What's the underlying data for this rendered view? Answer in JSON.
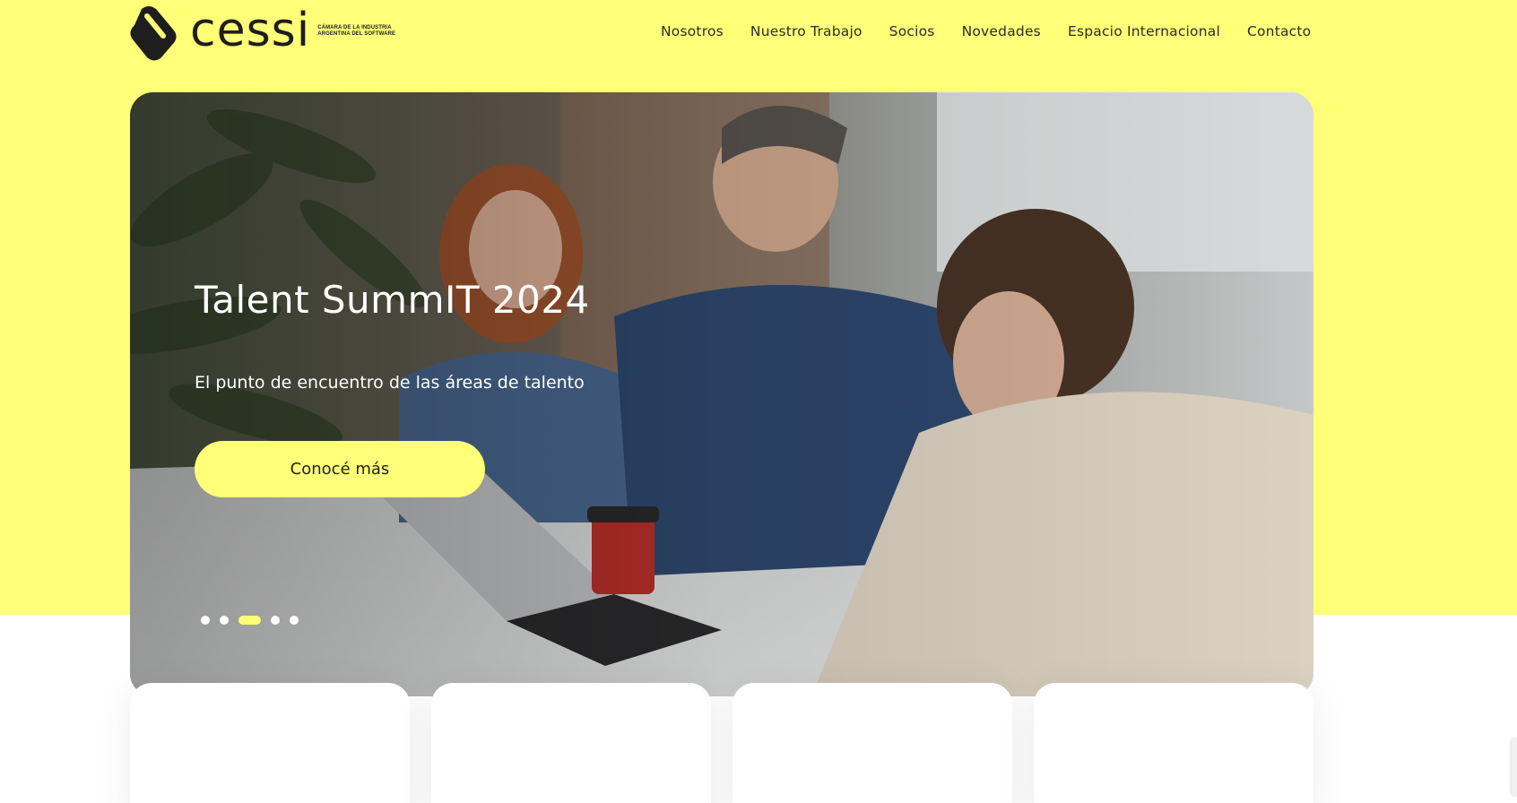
{
  "brand": {
    "name": "cessi",
    "subtitle_line1": "CÁMARA DE LA INDUSTRIA",
    "subtitle_line2": "ARGENTINA DEL SOFTWARE",
    "logo_icon": "cessi-logo-mark"
  },
  "nav": {
    "items": [
      {
        "label": "Nosotros"
      },
      {
        "label": "Nuestro Trabajo"
      },
      {
        "label": "Socios"
      },
      {
        "label": "Novedades"
      },
      {
        "label": "Espacio Internacional"
      },
      {
        "label": "Contacto"
      }
    ]
  },
  "hero": {
    "title": "Talent SummIT 2024",
    "subtitle": "El punto de encuentro de las áreas de talento",
    "cta_label": "Conocé más",
    "slide_count": 5,
    "active_slide": 3
  },
  "colors": {
    "accent": "#ffff78",
    "text_dark": "#1e1e1e",
    "white": "#ffffff"
  }
}
